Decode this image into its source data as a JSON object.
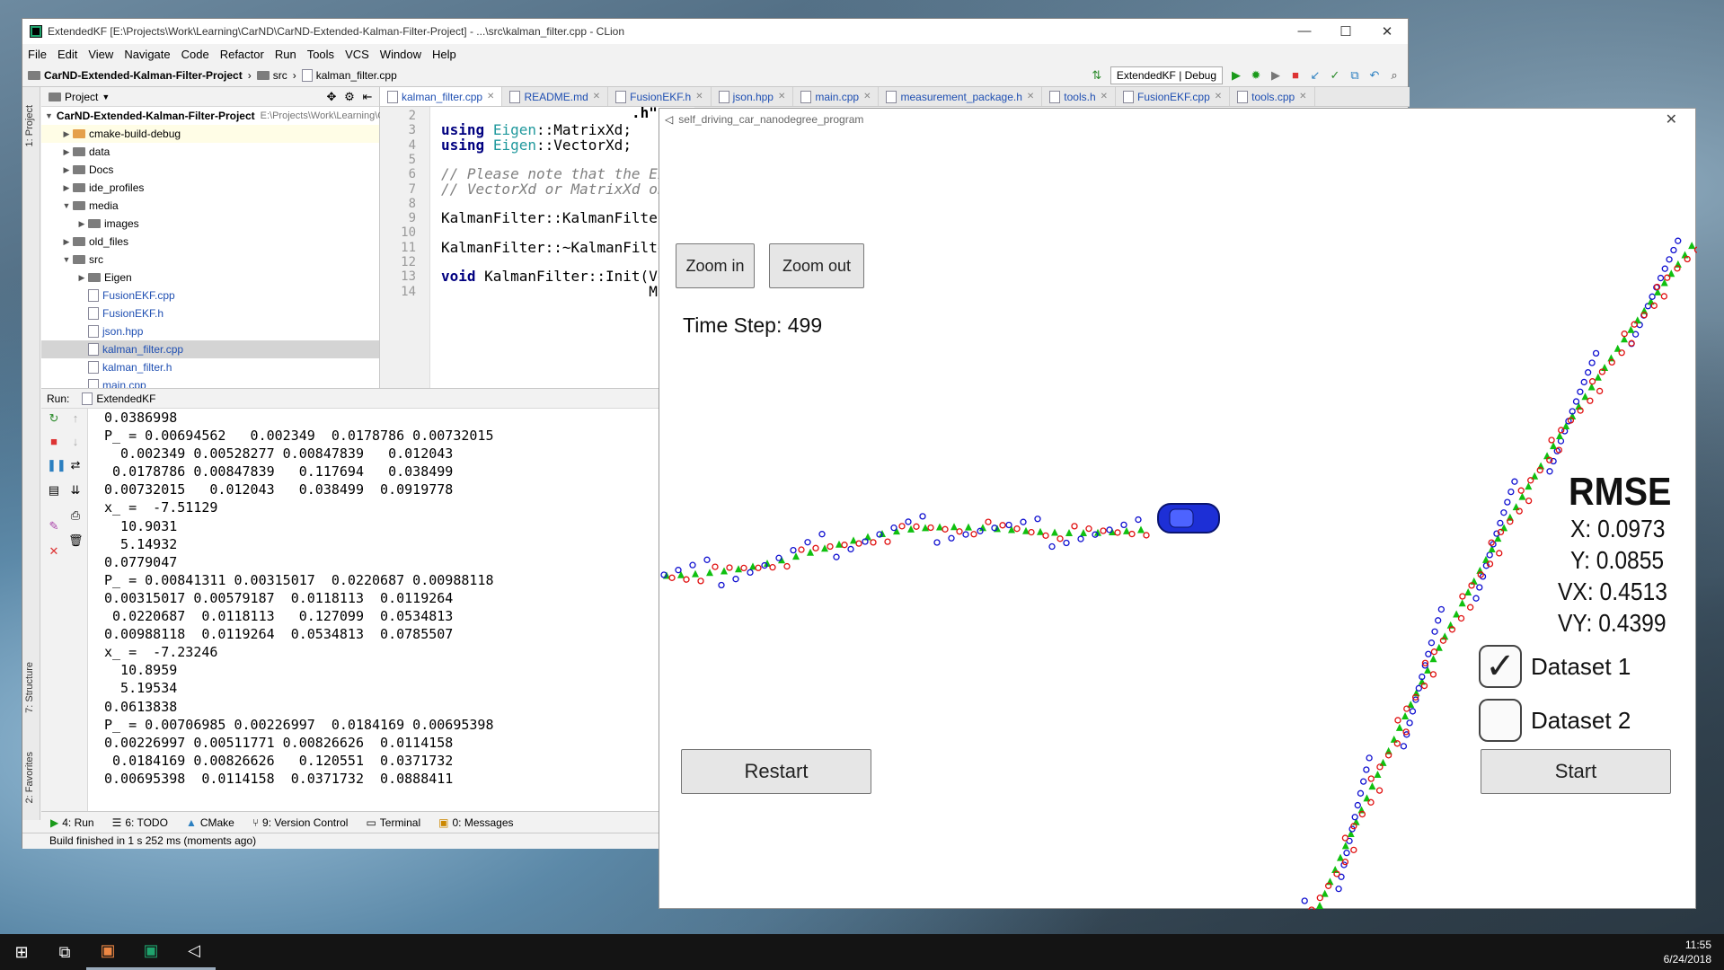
{
  "ide": {
    "title": "ExtendedKF [E:\\Projects\\Work\\Learning\\CarND\\CarND-Extended-Kalman-Filter-Project] - ...\\src\\kalman_filter.cpp - CLion",
    "menu": [
      "File",
      "Edit",
      "View",
      "Navigate",
      "Code",
      "Refactor",
      "Run",
      "Tools",
      "VCS",
      "Window",
      "Help"
    ],
    "breadcrumb": [
      "CarND-Extended-Kalman-Filter-Project",
      "src",
      "kalman_filter.cpp"
    ],
    "run_config": "ExtendedKF | Debug",
    "project_panel_label": "Project",
    "side_tabs": {
      "project": "1: Project",
      "structure": "7: Structure",
      "favorites": "2: Favorites"
    },
    "tree": [
      {
        "indent": 0,
        "arrow": "▼",
        "icon": "folder",
        "label": "CarND-Extended-Kalman-Filter-Project",
        "hint": "E:\\Projects\\Work\\Learning\\CarND\\CarND-Extended-Kalman-Filter-Project"
      },
      {
        "indent": 1,
        "arrow": "▶",
        "icon": "folder-orange",
        "label": "cmake-build-debug",
        "hint": ""
      },
      {
        "indent": 1,
        "arrow": "▶",
        "icon": "folder",
        "label": "data",
        "hint": ""
      },
      {
        "indent": 1,
        "arrow": "▶",
        "icon": "folder",
        "label": "Docs",
        "hint": ""
      },
      {
        "indent": 1,
        "arrow": "▶",
        "icon": "folder",
        "label": "ide_profiles",
        "hint": ""
      },
      {
        "indent": 1,
        "arrow": "▼",
        "icon": "folder",
        "label": "media",
        "hint": ""
      },
      {
        "indent": 2,
        "arrow": "▶",
        "icon": "folder",
        "label": "images",
        "hint": ""
      },
      {
        "indent": 1,
        "arrow": "▶",
        "icon": "folder",
        "label": "old_files",
        "hint": ""
      },
      {
        "indent": 1,
        "arrow": "▼",
        "icon": "folder",
        "label": "src",
        "hint": ""
      },
      {
        "indent": 2,
        "arrow": "▶",
        "icon": "folder",
        "label": "Eigen",
        "hint": ""
      },
      {
        "indent": 2,
        "arrow": "",
        "icon": "file",
        "label": "FusionEKF.cpp",
        "hint": ""
      },
      {
        "indent": 2,
        "arrow": "",
        "icon": "file",
        "label": "FusionEKF.h",
        "hint": ""
      },
      {
        "indent": 2,
        "arrow": "",
        "icon": "file",
        "label": "json.hpp",
        "hint": ""
      },
      {
        "indent": 2,
        "arrow": "",
        "icon": "file",
        "label": "kalman_filter.cpp",
        "hint": ""
      },
      {
        "indent": 2,
        "arrow": "",
        "icon": "file",
        "label": "kalman_filter.h",
        "hint": ""
      },
      {
        "indent": 2,
        "arrow": "",
        "icon": "file",
        "label": "main.cpp",
        "hint": ""
      }
    ],
    "tabs": [
      "kalman_filter.cpp",
      "README.md",
      "FusionEKF.h",
      "json.hpp",
      "main.cpp",
      "measurement_package.h",
      "tools.h",
      "FusionEKF.cpp",
      "tools.cpp"
    ],
    "editor_lines": [
      {
        "n": "2",
        "text": ""
      },
      {
        "n": "3",
        "text": "using Eigen::MatrixXd;"
      },
      {
        "n": "4",
        "text": "using Eigen::VectorXd;"
      },
      {
        "n": "5",
        "text": ""
      },
      {
        "n": "6",
        "text": "// Please note that the Eig"
      },
      {
        "n": "7",
        "text": "// VectorXd or MatrixXd obj"
      },
      {
        "n": "8",
        "text": ""
      },
      {
        "n": "9",
        "text": "KalmanFilter::KalmanFilter("
      },
      {
        "n": "10",
        "text": ""
      },
      {
        "n": "11",
        "text": "KalmanFilter::~KalmanFilter"
      },
      {
        "n": "12",
        "text": ""
      },
      {
        "n": "13",
        "text": "void KalmanFilter::Init(Vec"
      },
      {
        "n": "14",
        "text": "                        Mat"
      }
    ],
    "editor_extra": ".h\"",
    "run_label": "Run:",
    "run_tab": "ExtendedKF",
    "console": "0.0386998\nP_ = 0.00694562   0.002349  0.0178786 0.00732015\n  0.002349 0.00528277 0.00847839   0.012043\n 0.0178786 0.00847839   0.117694   0.038499\n0.00732015   0.012043   0.038499  0.0919778\nx_ =  -7.51129\n  10.9031\n  5.14932\n0.0779047\nP_ = 0.00841311 0.00315017  0.0220687 0.00988118\n0.00315017 0.00579187  0.0118113  0.0119264\n 0.0220687  0.0118113   0.127099  0.0534813\n0.00988118  0.0119264  0.0534813  0.0785507\nx_ =  -7.23246\n  10.8959\n  5.19534\n0.0613838\nP_ = 0.00706985 0.00226997  0.0184169 0.00695398\n0.00226997 0.00511771 0.00826626  0.0114158\n 0.0184169 0.00826626   0.120551  0.0371732\n0.00695398  0.0114158  0.0371732  0.0888411",
    "bottom_tabs": [
      "4: Run",
      "6: TODO",
      "CMake",
      "9: Version Control",
      "Terminal",
      "0: Messages"
    ],
    "status": "Build finished in 1 s 252 ms (moments ago)"
  },
  "sim": {
    "title": "self_driving_car_nanodegree_program",
    "zoom_in": "Zoom in",
    "zoom_out": "Zoom out",
    "time_step": "Time Step: 499",
    "rmse_title": "RMSE",
    "rmse": {
      "x": "X: 0.0973",
      "y": "Y: 0.0855",
      "vx": "VX: 0.4513",
      "vy": "VY: 0.4399"
    },
    "dataset1": "Dataset 1",
    "dataset1_checked": true,
    "dataset2": "Dataset 2",
    "dataset2_checked": false,
    "restart": "Restart",
    "start": "Start",
    "colors": {
      "lidar": "#e01010",
      "radar": "#1010d0",
      "estimate": "#10c010",
      "car": "#1d2fd6"
    }
  },
  "taskbar": {
    "time": "11:55",
    "date": "6/24/2018"
  }
}
